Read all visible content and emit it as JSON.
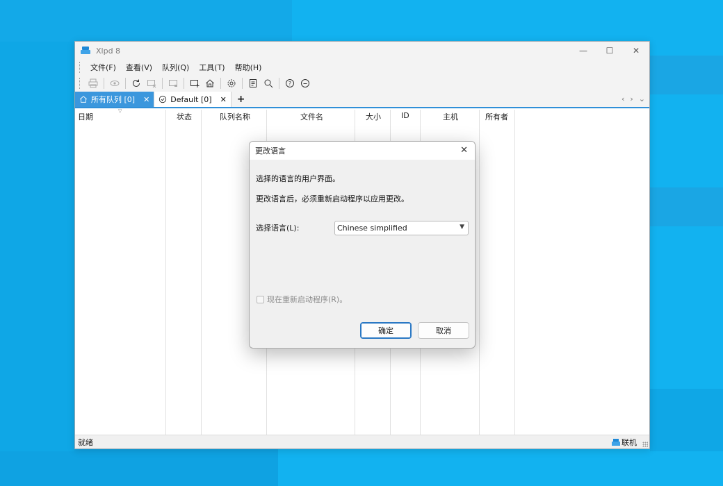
{
  "app": {
    "title": "Xlpd 8"
  },
  "window_controls": {
    "minimize": "—",
    "maximize": "☐",
    "close": "✕"
  },
  "menu": [
    "文件(F)",
    "查看(V)",
    "队列(Q)",
    "工具(T)",
    "帮助(H)"
  ],
  "tabs": [
    {
      "label": "所有队列 [0]",
      "close": "✕"
    },
    {
      "label": "Default [0]",
      "close": "✕"
    }
  ],
  "tab_add": "+",
  "tab_nav": {
    "prev": "‹",
    "next": "›",
    "menu": "⌄"
  },
  "columns": [
    "日期",
    "状态",
    "队列名称",
    "文件名",
    "大小",
    "ID",
    "主机",
    "所有者"
  ],
  "status": {
    "left": "就绪",
    "right": "联机"
  },
  "dialog": {
    "title": "更改语言",
    "close": "✕",
    "line1": "选择的语言的用户界面。",
    "line2": "更改语言后，必须重新启动程序以应用更改。",
    "language_label": "选择语言(L):",
    "language_value": "Chinese simplified",
    "restart_label": "现在重新启动程序(R)。",
    "restart_checked": false,
    "ok": "确定",
    "cancel": "取消"
  },
  "colors": {
    "desktop": "#12b2f0",
    "accent": "#3b97dd"
  }
}
